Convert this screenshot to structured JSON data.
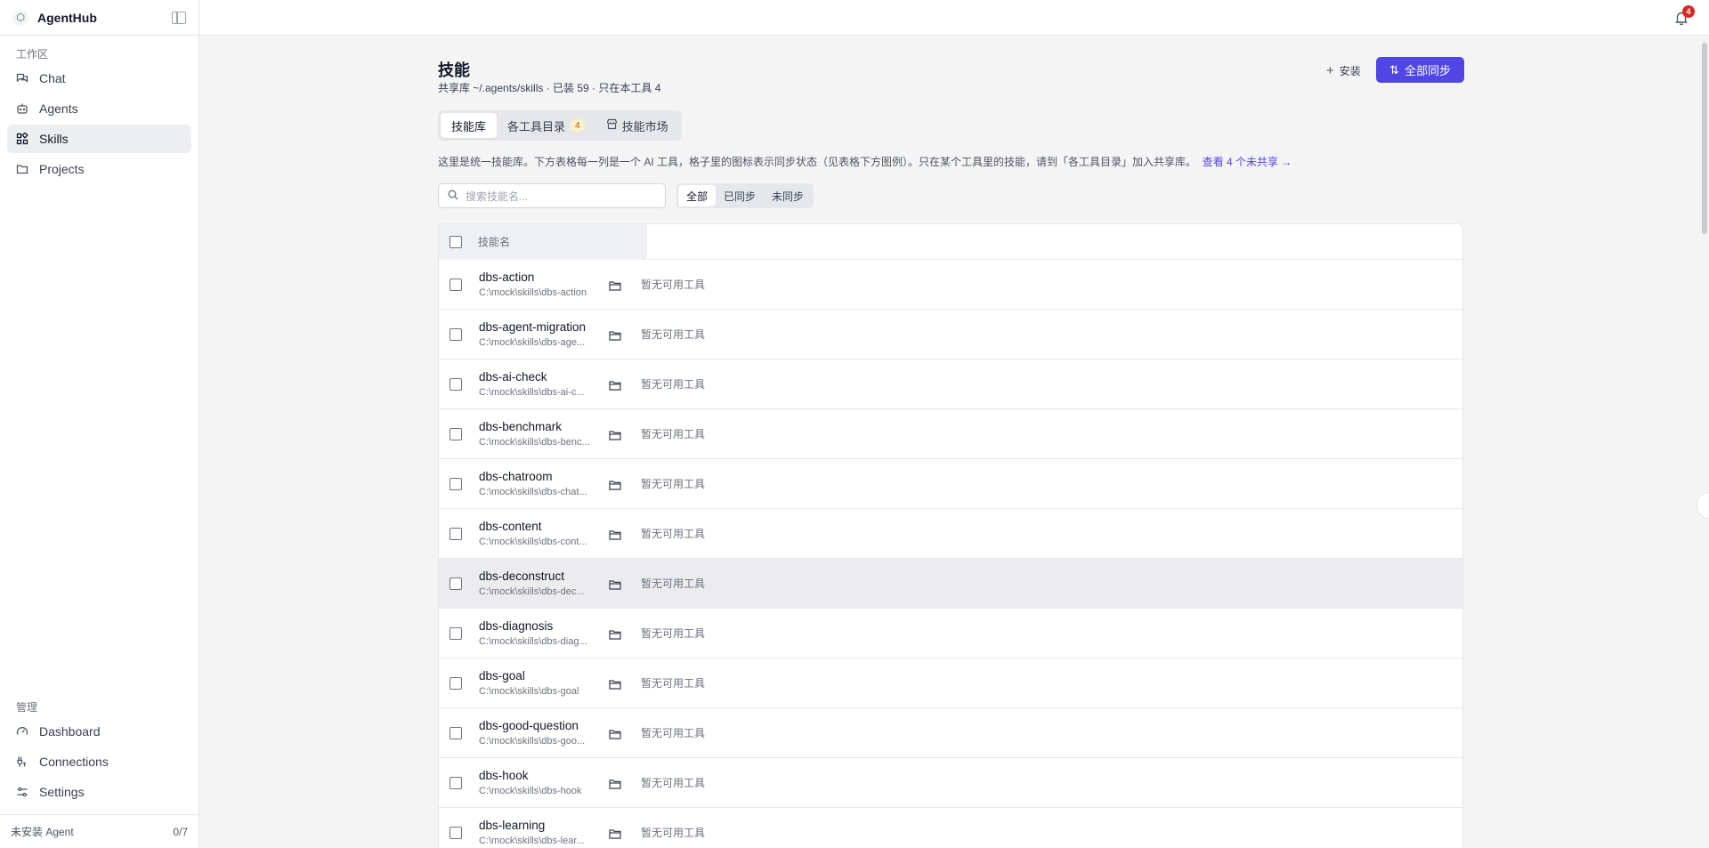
{
  "app": {
    "name": "AgentHub",
    "logo_glyph": "⬡"
  },
  "sidebar": {
    "workspace_label": "工作区",
    "workspace_items": [
      {
        "label": "Chat",
        "icon": "chat-icon"
      },
      {
        "label": "Agents",
        "icon": "bot-icon"
      },
      {
        "label": "Skills",
        "icon": "skills-grid-icon",
        "active": true
      },
      {
        "label": "Projects",
        "icon": "folder-icon"
      }
    ],
    "manage_label": "管理",
    "manage_items": [
      {
        "label": "Dashboard",
        "icon": "gauge-icon"
      },
      {
        "label": "Connections",
        "icon": "connections-icon"
      },
      {
        "label": "Settings",
        "icon": "sliders-icon"
      }
    ],
    "footer": {
      "label": "未安装 Agent",
      "count": "0/7"
    }
  },
  "topbar": {
    "notification_count": "4"
  },
  "page": {
    "title": "技能",
    "subtitle": "共享库 ~/.agents/skills · 已装 59 · 只在本工具 4",
    "install_label": "安装",
    "sync_all_label": "全部同步",
    "tabs": [
      {
        "label": "技能库",
        "active": true
      },
      {
        "label": "各工具目录",
        "badge": "4"
      },
      {
        "label": "技能市场",
        "icon": "store-icon"
      }
    ],
    "description": "这里是统一技能库。下方表格每一列是一个 AI 工具，格子里的图标表示同步状态（见表格下方图例）。只在某个工具里的技能，请到「各工具目录」加入共享库。",
    "description_link": "查看 4 个未共享 →",
    "search_placeholder": "搜索技能名...",
    "filters": [
      {
        "label": "全部",
        "active": true
      },
      {
        "label": "已同步"
      },
      {
        "label": "未同步"
      }
    ]
  },
  "table": {
    "header_skill": "技能名",
    "rows": [
      {
        "name": "dbs-action",
        "path": "C:\\mock\\skills\\dbs-action",
        "status": "暂无可用工具"
      },
      {
        "name": "dbs-agent-migration",
        "path": "C:\\mock\\skills\\dbs-age...",
        "status": "暂无可用工具"
      },
      {
        "name": "dbs-ai-check",
        "path": "C:\\mock\\skills\\dbs-ai-c...",
        "status": "暂无可用工具"
      },
      {
        "name": "dbs-benchmark",
        "path": "C:\\mock\\skills\\dbs-benc...",
        "status": "暂无可用工具"
      },
      {
        "name": "dbs-chatroom",
        "path": "C:\\mock\\skills\\dbs-chat...",
        "status": "暂无可用工具"
      },
      {
        "name": "dbs-content",
        "path": "C:\\mock\\skills\\dbs-cont...",
        "status": "暂无可用工具"
      },
      {
        "name": "dbs-deconstruct",
        "path": "C:\\mock\\skills\\dbs-dec...",
        "status": "暂无可用工具",
        "hover": true
      },
      {
        "name": "dbs-diagnosis",
        "path": "C:\\mock\\skills\\dbs-diag...",
        "status": "暂无可用工具"
      },
      {
        "name": "dbs-goal",
        "path": "C:\\mock\\skills\\dbs-goal",
        "status": "暂无可用工具"
      },
      {
        "name": "dbs-good-question",
        "path": "C:\\mock\\skills\\dbs-goo...",
        "status": "暂无可用工具"
      },
      {
        "name": "dbs-hook",
        "path": "C:\\mock\\skills\\dbs-hook",
        "status": "暂无可用工具"
      },
      {
        "name": "dbs-learning",
        "path": "C:\\mock\\skills\\dbs-lear...",
        "status": "暂无可用工具"
      }
    ]
  },
  "colors": {
    "accent": "#4f46e5",
    "badge": "#dc2626",
    "active_nav_bg": "#eceef1"
  }
}
